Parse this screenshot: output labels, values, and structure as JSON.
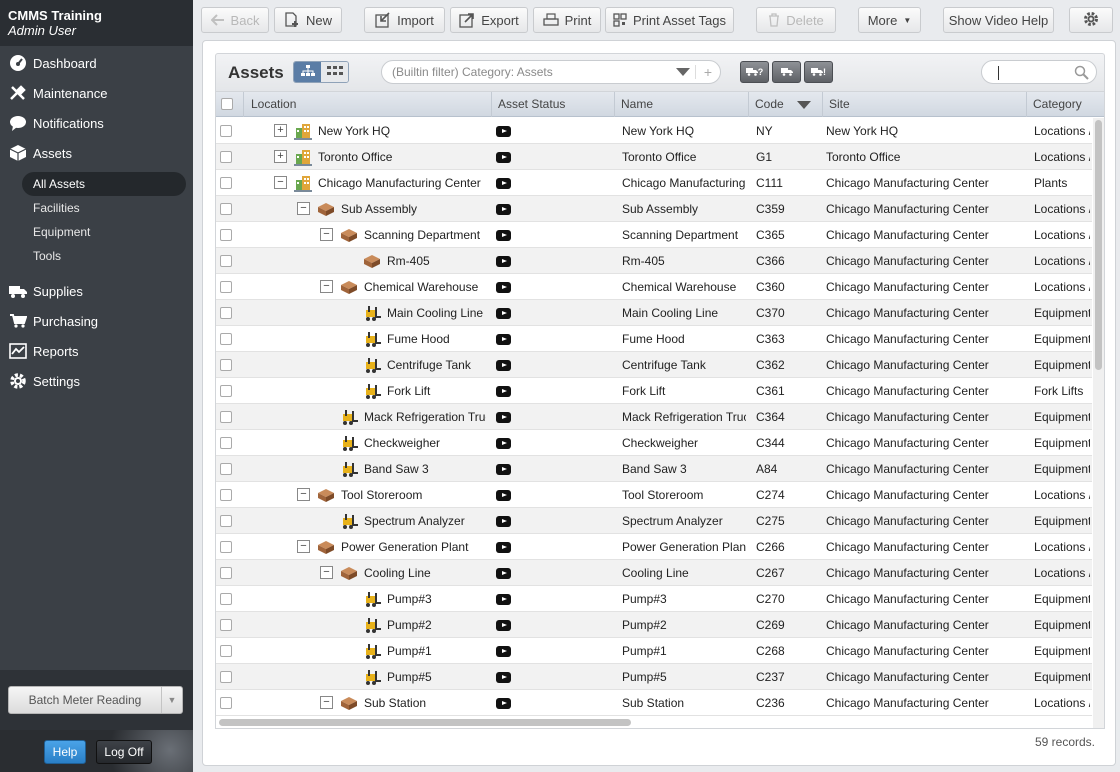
{
  "app": {
    "title": "CMMS Training",
    "user": "Admin User"
  },
  "nav": {
    "dashboard": "Dashboard",
    "maintenance": "Maintenance",
    "notifications": "Notifications",
    "assets": "Assets",
    "sub": [
      "All Assets",
      "Facilities",
      "Equipment",
      "Tools"
    ],
    "supplies": "Supplies",
    "purchasing": "Purchasing",
    "reports": "Reports",
    "settings": "Settings"
  },
  "sidebar_bottom": {
    "batch": "Batch Meter Reading",
    "help": "Help",
    "logoff": "Log Off"
  },
  "toolbar": {
    "back": "Back",
    "new": "New",
    "import": "Import",
    "export": "Export",
    "print": "Print",
    "print_tags": "Print Asset Tags",
    "delete": "Delete",
    "more": "More",
    "video": "Show Video Help"
  },
  "panel": {
    "title": "Assets",
    "filter": "(Builtin filter) Category: Assets",
    "quick_buttons": [
      "?",
      "",
      "!"
    ],
    "search_placeholder": ""
  },
  "columns": {
    "location": "Location",
    "status": "Asset Status",
    "name": "Name",
    "code": "Code",
    "site": "Site",
    "category": "Category"
  },
  "rows": [
    {
      "loc": "New York HQ",
      "lvl": 0,
      "toggle": "+",
      "icon": "building",
      "name": "New York HQ",
      "code": "NY",
      "site": "New York HQ",
      "cat": "Locations /"
    },
    {
      "loc": "Toronto Office",
      "lvl": 0,
      "toggle": "+",
      "icon": "building",
      "name": "Toronto Office",
      "code": "G1",
      "site": "Toronto Office",
      "cat": "Locations /"
    },
    {
      "loc": "Chicago Manufacturing Center",
      "lvl": 0,
      "toggle": "−",
      "icon": "building",
      "name": "Chicago Manufacturing...",
      "code": "C111",
      "site": "Chicago Manufacturing Center",
      "cat": "Plants"
    },
    {
      "loc": "Sub Assembly",
      "lvl": 1,
      "toggle": "−",
      "icon": "room",
      "name": "Sub Assembly",
      "code": "C359",
      "site": "Chicago Manufacturing Center",
      "cat": "Locations /"
    },
    {
      "loc": "Scanning Department",
      "lvl": 2,
      "toggle": "−",
      "icon": "room",
      "name": "Scanning Department",
      "code": "C365",
      "site": "Chicago Manufacturing Center",
      "cat": "Locations /"
    },
    {
      "loc": "Rm-405",
      "lvl": 3,
      "toggle": "",
      "icon": "room",
      "name": "Rm-405",
      "code": "C366",
      "site": "Chicago Manufacturing Center",
      "cat": "Locations /"
    },
    {
      "loc": "Chemical Warehouse",
      "lvl": 2,
      "toggle": "−",
      "icon": "room",
      "name": "Chemical Warehouse",
      "code": "C360",
      "site": "Chicago Manufacturing Center",
      "cat": "Locations /"
    },
    {
      "loc": "Main Cooling Line",
      "lvl": 3,
      "toggle": "",
      "icon": "equip",
      "name": "Main Cooling Line",
      "code": "C370",
      "site": "Chicago Manufacturing Center",
      "cat": "Equipment"
    },
    {
      "loc": "Fume Hood",
      "lvl": 3,
      "toggle": "",
      "icon": "equip",
      "name": "Fume Hood",
      "code": "C363",
      "site": "Chicago Manufacturing Center",
      "cat": "Equipment"
    },
    {
      "loc": "Centrifuge Tank",
      "lvl": 3,
      "toggle": "",
      "icon": "equip",
      "name": "Centrifuge Tank",
      "code": "C362",
      "site": "Chicago Manufacturing Center",
      "cat": "Equipment"
    },
    {
      "loc": "Fork Lift",
      "lvl": 3,
      "toggle": "",
      "icon": "equip",
      "name": "Fork Lift",
      "code": "C361",
      "site": "Chicago Manufacturing Center",
      "cat": "Fork Lifts"
    },
    {
      "loc": "Mack Refrigeration Truck",
      "lvl": 2,
      "toggle": "",
      "icon": "equip",
      "name": "Mack Refrigeration Truck",
      "code": "C364",
      "site": "Chicago Manufacturing Center",
      "cat": "Equipment"
    },
    {
      "loc": "Checkweigher",
      "lvl": 2,
      "toggle": "",
      "icon": "equip",
      "name": "Checkweigher",
      "code": "C344",
      "site": "Chicago Manufacturing Center",
      "cat": "Equipment"
    },
    {
      "loc": "Band Saw 3",
      "lvl": 2,
      "toggle": "",
      "icon": "equip",
      "name": "Band Saw 3",
      "code": "A84",
      "site": "Chicago Manufacturing Center",
      "cat": "Equipment"
    },
    {
      "loc": "Tool Storeroom",
      "lvl": 1,
      "toggle": "−",
      "icon": "room",
      "name": "Tool Storeroom",
      "code": "C274",
      "site": "Chicago Manufacturing Center",
      "cat": "Locations /"
    },
    {
      "loc": "Spectrum Analyzer",
      "lvl": 2,
      "toggle": "",
      "icon": "equip",
      "name": "Spectrum Analyzer",
      "code": "C275",
      "site": "Chicago Manufacturing Center",
      "cat": "Equipment"
    },
    {
      "loc": "Power Generation Plant",
      "lvl": 1,
      "toggle": "−",
      "icon": "room",
      "name": "Power Generation Plant",
      "code": "C266",
      "site": "Chicago Manufacturing Center",
      "cat": "Locations /"
    },
    {
      "loc": "Cooling Line",
      "lvl": 2,
      "toggle": "−",
      "icon": "room",
      "name": "Cooling Line",
      "code": "C267",
      "site": "Chicago Manufacturing Center",
      "cat": "Locations /"
    },
    {
      "loc": "Pump#3",
      "lvl": 3,
      "toggle": "",
      "icon": "equip",
      "name": "Pump#3",
      "code": "C270",
      "site": "Chicago Manufacturing Center",
      "cat": "Equipment"
    },
    {
      "loc": "Pump#2",
      "lvl": 3,
      "toggle": "",
      "icon": "equip",
      "name": "Pump#2",
      "code": "C269",
      "site": "Chicago Manufacturing Center",
      "cat": "Equipment"
    },
    {
      "loc": "Pump#1",
      "lvl": 3,
      "toggle": "",
      "icon": "equip",
      "name": "Pump#1",
      "code": "C268",
      "site": "Chicago Manufacturing Center",
      "cat": "Equipment"
    },
    {
      "loc": "Pump#5",
      "lvl": 3,
      "toggle": "",
      "icon": "equip",
      "name": "Pump#5",
      "code": "C237",
      "site": "Chicago Manufacturing Center",
      "cat": "Equipment"
    },
    {
      "loc": "Sub Station",
      "lvl": 2,
      "toggle": "−",
      "icon": "room",
      "name": "Sub Station",
      "code": "C236",
      "site": "Chicago Manufacturing Center",
      "cat": "Locations /"
    }
  ],
  "records": "59 records."
}
